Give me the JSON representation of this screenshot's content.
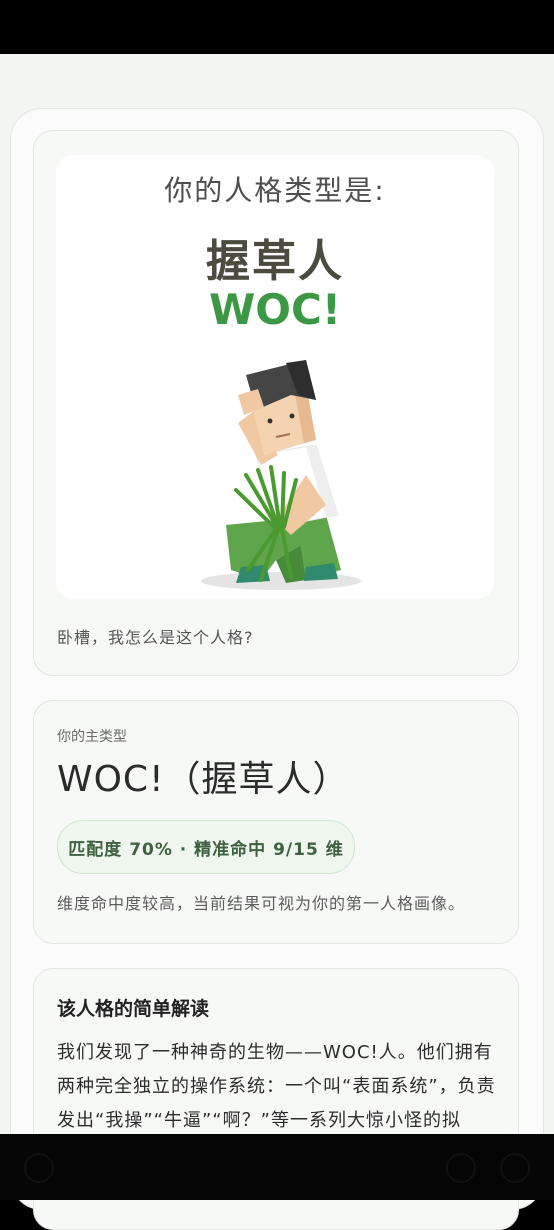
{
  "hero": {
    "subtitle": "你的人格类型是:",
    "title": "握草人",
    "code": "WOC!",
    "caption": "卧槽，我怎么是这个人格?"
  },
  "main": {
    "label": "你的主类型",
    "type": "WOC!（握草人）",
    "match": "匹配度 70% · 精准命中 9/15 维",
    "desc": "维度命中度较高，当前结果可视为你的第一人格画像。"
  },
  "reading": {
    "title": "该人格的简单解读",
    "body": "我们发现了一种神奇的生物——WOC!人。他们拥有两种完全独立的操作系统：一个叫“表面系统”，负责发出“我操”“牛逼”“啊？”等一系列大惊小怪的拟"
  },
  "colors": {
    "accent_green": "#3d9845",
    "pill_bg": "#eef6ee",
    "text_dark": "#2b2b2b"
  },
  "icons": {
    "figure": "confused-person-holding-grass-illustration",
    "nav_left": "back-circle-icon",
    "nav_right": "home-circle-icon"
  }
}
